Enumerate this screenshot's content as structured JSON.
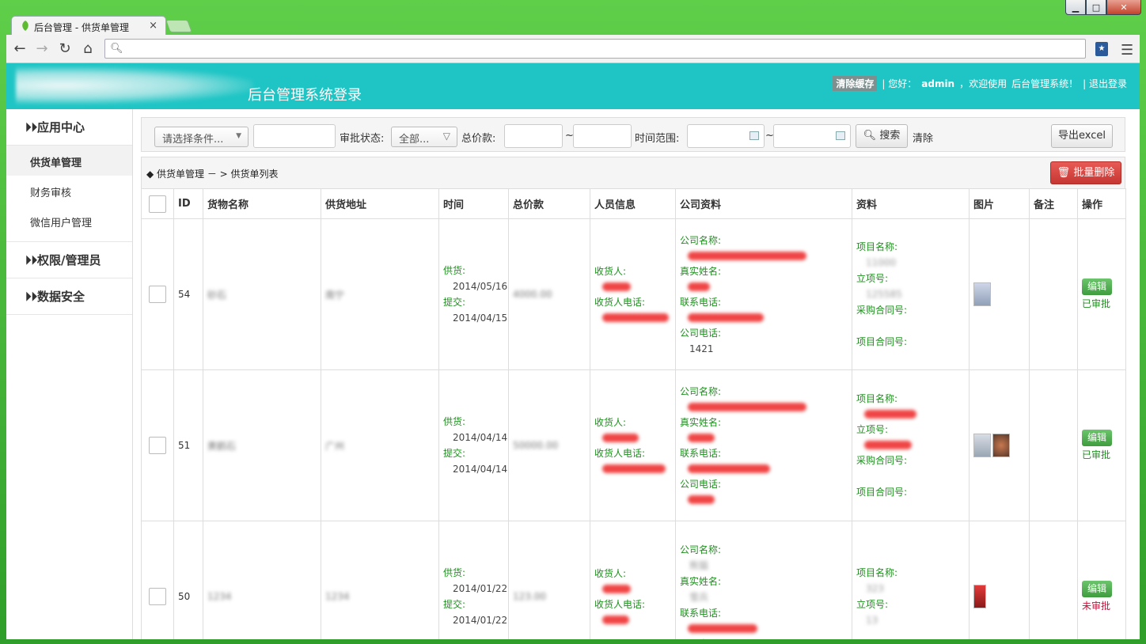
{
  "browser": {
    "tab_title": "后台管理 - 供货单管理",
    "tab_close": "×",
    "address": ""
  },
  "window_controls": {
    "minimize": "▁",
    "maximize": "□",
    "close": "✕"
  },
  "header": {
    "title": "后台管理系统登录",
    "clear_cache": "清除缓存",
    "greeting_prefix": "| 您好：",
    "user": "admin",
    "greeting_suffix": "，欢迎使用",
    "system_name": "后台管理系统！",
    "logout": "| 退出登录"
  },
  "sidebar": {
    "groups": [
      {
        "label": "应用中心"
      },
      {
        "label": "权限/管理员"
      },
      {
        "label": "数据安全"
      }
    ],
    "items": [
      {
        "label": "供货单管理",
        "active": true
      },
      {
        "label": "财务审核"
      },
      {
        "label": "微信用户管理"
      }
    ]
  },
  "filters": {
    "condition_placeholder": "请选择条件...",
    "approval_label": "审批状态:",
    "approval_value": "全部...",
    "total_label": "总价款:",
    "tilde": "~",
    "time_label": "时间范围:",
    "search_label": "搜索",
    "clear_label": "清除",
    "export_label": "导出excel"
  },
  "list": {
    "breadcrumb": "◆ 供货单管理 － > 供货单列表",
    "batch_delete": "批量删除",
    "columns": [
      "ID",
      "货物名称",
      "供货地址",
      "时间",
      "总价款",
      "人员信息",
      "公司资料",
      "资料",
      "图片",
      "备注",
      "操作"
    ]
  },
  "labels": {
    "supply": "供货:",
    "submit": "提交:",
    "receiver": "收货人:",
    "receiver_phone": "收货人电话:",
    "company_name": "公司名称:",
    "real_name": "真实姓名:",
    "contact_phone": "联系电话:",
    "company_phone": "公司电话:",
    "project_name": "项目名称:",
    "project_no": "立项号:",
    "purchase_contract": "采购合同号:",
    "project_contract": "项目合同号:",
    "edit": "编辑"
  },
  "rows": [
    {
      "id": "54",
      "goods": "砂石",
      "address": "南宁",
      "supply_date": "2014/05/16",
      "submit_date": "2014/04/15",
      "total": "4000.00",
      "company_phone": "1421",
      "project_name": "11000",
      "project_no": "125585",
      "status": "已审批",
      "approved": true
    },
    {
      "id": "51",
      "goods": "黄鹤石",
      "address": "广州",
      "supply_date": "2014/04/14",
      "submit_date": "2014/04/14",
      "total": "50000.00",
      "status": "已审批",
      "approved": true
    },
    {
      "id": "50",
      "goods": "1234",
      "address": "1234",
      "supply_date": "2014/01/22",
      "submit_date": "2014/01/22",
      "total": "123.00",
      "company_name": "熊猫",
      "real_name": "雪兵",
      "project_name": "323",
      "project_no": "13",
      "status": "未审批",
      "approved": false
    }
  ],
  "colors": {
    "header_bg": "#1fc5c5",
    "label_green": "#1f8f1f",
    "danger": "#c63733",
    "pending": "#c0143c"
  }
}
